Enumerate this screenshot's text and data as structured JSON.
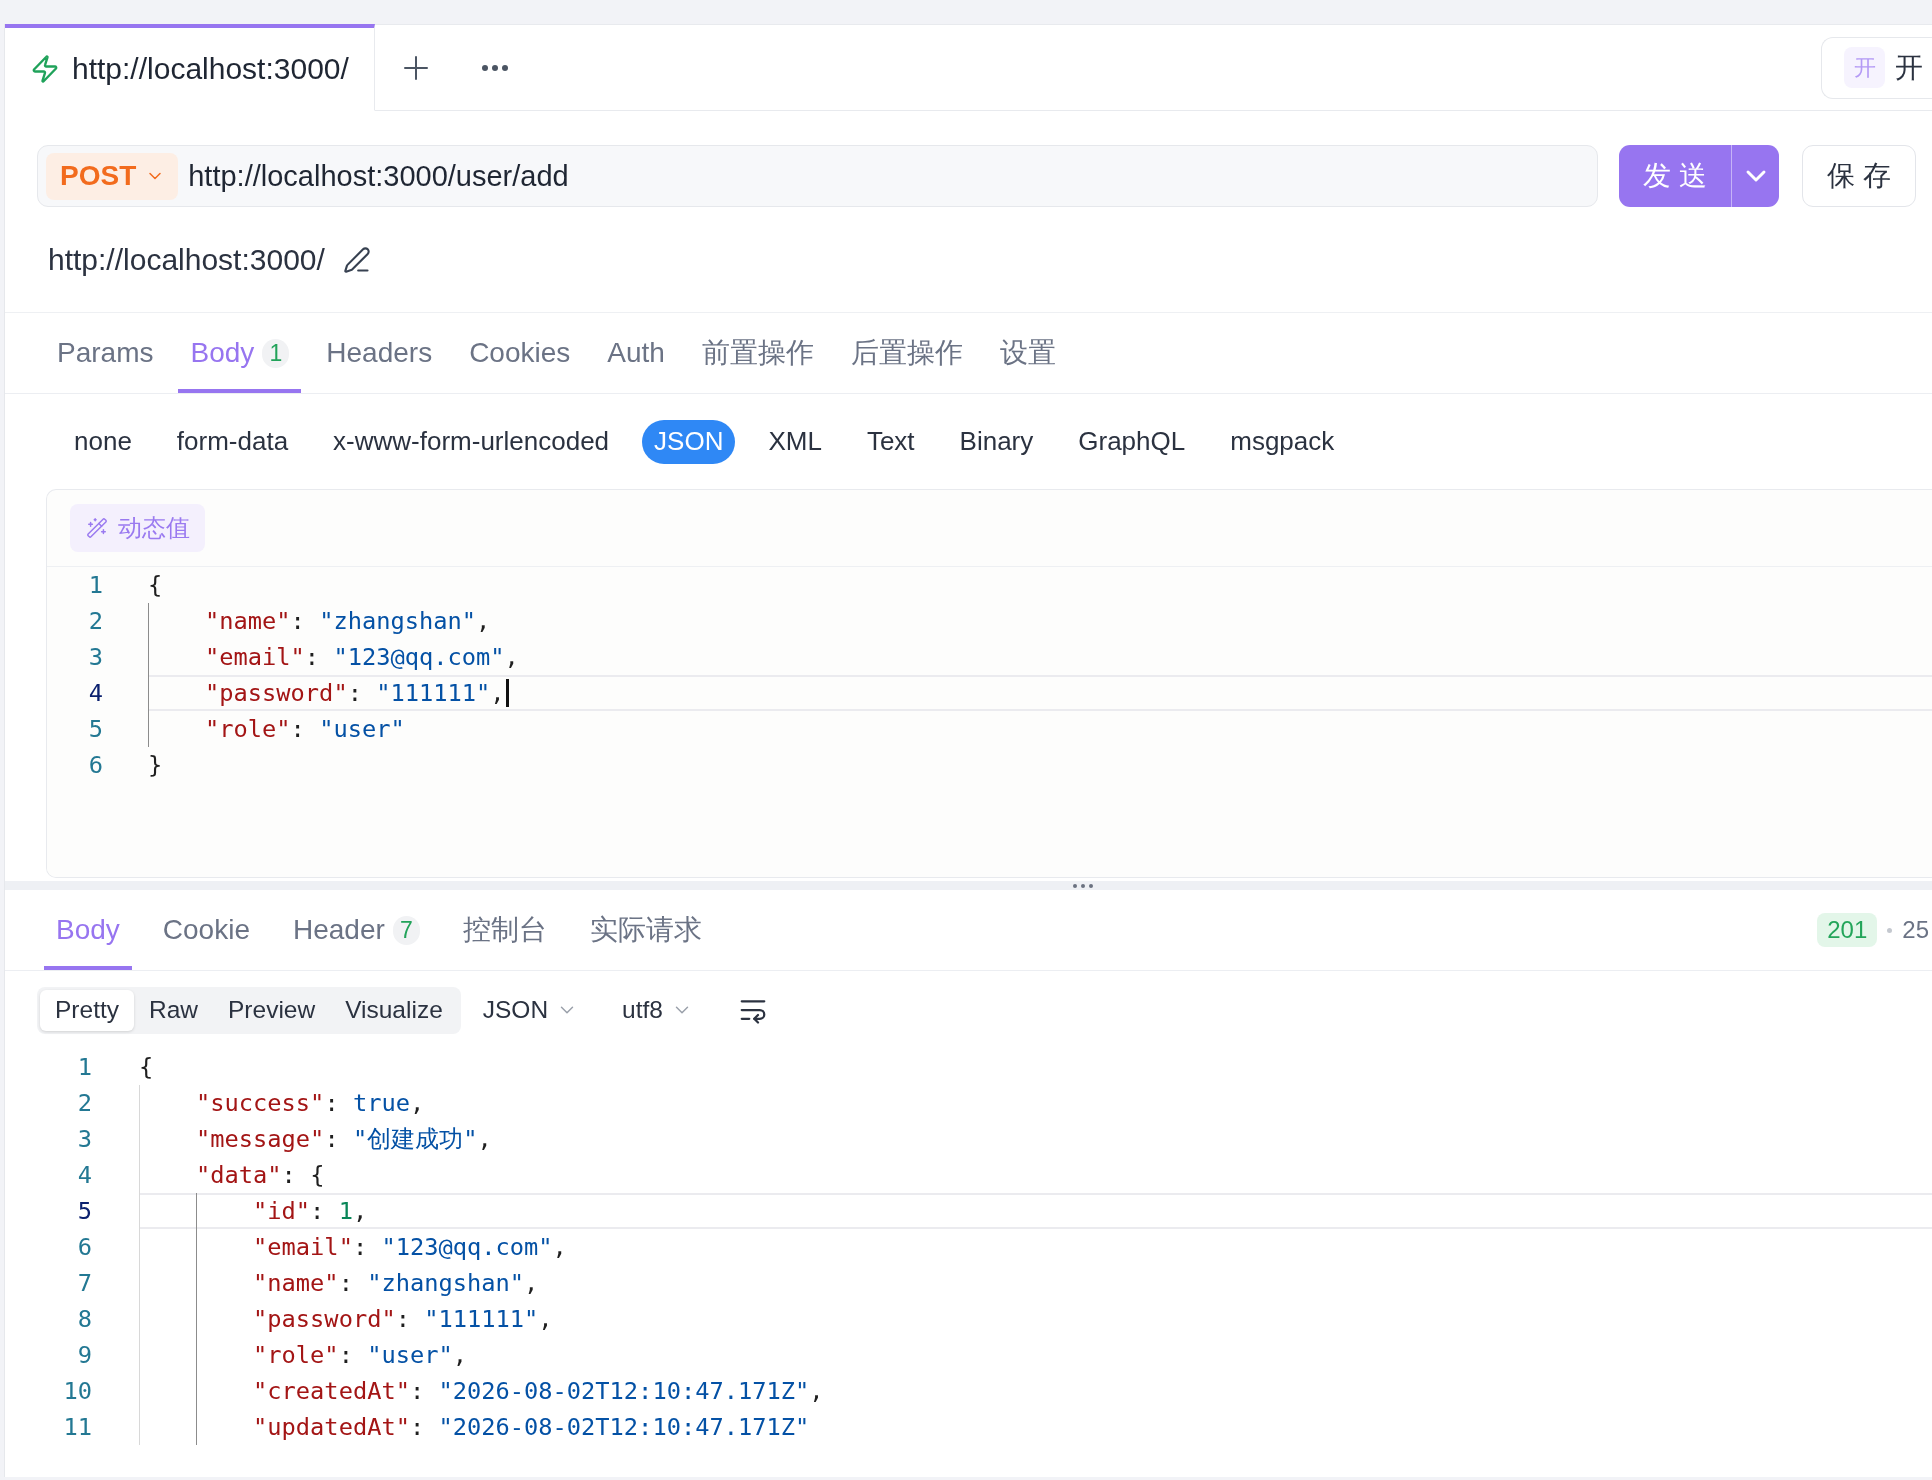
{
  "tabs": [
    {
      "label": "http://localhost:3000/",
      "selected": true
    }
  ],
  "environment": {
    "avatar": "开",
    "name": "开"
  },
  "request": {
    "method": "POST",
    "url": "http://localhost:3000/user/add",
    "send_label": "发 送",
    "save_label": "保 存",
    "base_url": "http://localhost:3000/"
  },
  "request_tabs": [
    {
      "label": "Params",
      "selected": false
    },
    {
      "label": "Body",
      "badge": "1",
      "selected": true
    },
    {
      "label": "Headers",
      "selected": false
    },
    {
      "label": "Cookies",
      "selected": false
    },
    {
      "label": "Auth",
      "selected": false
    },
    {
      "label": "前置操作",
      "selected": false
    },
    {
      "label": "后置操作",
      "selected": false
    },
    {
      "label": "设置",
      "selected": false
    }
  ],
  "body_types": [
    {
      "label": "none",
      "selected": false
    },
    {
      "label": "form-data",
      "selected": false
    },
    {
      "label": "x-www-form-urlencoded",
      "selected": false
    },
    {
      "label": "JSON",
      "selected": true
    },
    {
      "label": "XML",
      "selected": false
    },
    {
      "label": "Text",
      "selected": false
    },
    {
      "label": "Binary",
      "selected": false
    },
    {
      "label": "GraphQL",
      "selected": false
    },
    {
      "label": "msgpack",
      "selected": false
    }
  ],
  "body_editor": {
    "dynamic_value_button": "动态值",
    "focused": true,
    "lines": [
      {
        "number": "1",
        "current": false,
        "tokens": [
          {
            "kind": "open",
            "text": "{"
          }
        ]
      },
      {
        "number": "2",
        "current": false,
        "tokens": [
          {
            "kind": "key",
            "text": "\"name\""
          },
          {
            "kind": "punct",
            "text": ": "
          },
          {
            "kind": "string",
            "text": "\"zhangshan\""
          },
          {
            "kind": "punct",
            "text": ","
          }
        ]
      },
      {
        "number": "3",
        "current": false,
        "tokens": [
          {
            "kind": "key",
            "text": "\"email\""
          },
          {
            "kind": "punct",
            "text": ": "
          },
          {
            "kind": "string",
            "text": "\"123@qq.com\""
          },
          {
            "kind": "punct",
            "text": ","
          }
        ]
      },
      {
        "number": "4",
        "current": true,
        "tokens": [
          {
            "kind": "key",
            "text": "\"password\""
          },
          {
            "kind": "punct",
            "text": ": "
          },
          {
            "kind": "string",
            "text": "\"111111\""
          },
          {
            "kind": "punct",
            "text": ","
          }
        ]
      },
      {
        "number": "5",
        "current": false,
        "tokens": [
          {
            "kind": "key",
            "text": "\"role\""
          },
          {
            "kind": "punct",
            "text": ": "
          },
          {
            "kind": "string",
            "text": "\"user\""
          }
        ]
      },
      {
        "number": "6",
        "current": false,
        "tokens": [
          {
            "kind": "close",
            "text": "}"
          }
        ]
      }
    ]
  },
  "response": {
    "tabs": [
      {
        "label": "Body",
        "selected": true
      },
      {
        "label": "Cookie",
        "selected": false
      },
      {
        "label": "Header",
        "badge": "7",
        "selected": false
      },
      {
        "label": "控制台",
        "selected": false
      },
      {
        "label": "实际请求",
        "selected": false
      }
    ],
    "status": "201",
    "stat_2": "25",
    "view_modes": [
      {
        "label": "Pretty",
        "selected": true
      },
      {
        "label": "Raw",
        "selected": false
      },
      {
        "label": "Preview",
        "selected": false
      },
      {
        "label": "Visualize",
        "selected": false
      }
    ],
    "format": "JSON",
    "encoding": "utf8",
    "viewer": {
      "lines": [
        {
          "number": "1",
          "current": false,
          "tokens": [
            {
              "kind": "open",
              "text": "{"
            }
          ]
        },
        {
          "number": "2",
          "current": false,
          "tokens": [
            {
              "kind": "key",
              "text": "\"success\""
            },
            {
              "kind": "punct",
              "text": ": "
            },
            {
              "kind": "boolean",
              "text": "true"
            },
            {
              "kind": "punct",
              "text": ","
            }
          ]
        },
        {
          "number": "3",
          "current": false,
          "tokens": [
            {
              "kind": "key",
              "text": "\"message\""
            },
            {
              "kind": "punct",
              "text": ": "
            },
            {
              "kind": "string",
              "text": "\"创建成功\""
            },
            {
              "kind": "punct",
              "text": ","
            }
          ]
        },
        {
          "number": "4",
          "current": false,
          "tokens": [
            {
              "kind": "key",
              "text": "\"data\""
            },
            {
              "kind": "punct",
              "text": ": "
            },
            {
              "kind": "open",
              "text": "{"
            }
          ]
        },
        {
          "number": "5",
          "current": true,
          "tokens": [
            {
              "kind": "key",
              "text": "\"id\""
            },
            {
              "kind": "punct",
              "text": ": "
            },
            {
              "kind": "number",
              "text": "1"
            },
            {
              "kind": "punct",
              "text": ","
            }
          ]
        },
        {
          "number": "6",
          "current": false,
          "tokens": [
            {
              "kind": "key",
              "text": "\"email\""
            },
            {
              "kind": "punct",
              "text": ": "
            },
            {
              "kind": "string",
              "text": "\"123@qq.com\""
            },
            {
              "kind": "punct",
              "text": ","
            }
          ]
        },
        {
          "number": "7",
          "current": false,
          "tokens": [
            {
              "kind": "key",
              "text": "\"name\""
            },
            {
              "kind": "punct",
              "text": ": "
            },
            {
              "kind": "string",
              "text": "\"zhangshan\""
            },
            {
              "kind": "punct",
              "text": ","
            }
          ]
        },
        {
          "number": "8",
          "current": false,
          "tokens": [
            {
              "kind": "key",
              "text": "\"password\""
            },
            {
              "kind": "punct",
              "text": ": "
            },
            {
              "kind": "string",
              "text": "\"111111\""
            },
            {
              "kind": "punct",
              "text": ","
            }
          ]
        },
        {
          "number": "9",
          "current": false,
          "tokens": [
            {
              "kind": "key",
              "text": "\"role\""
            },
            {
              "kind": "punct",
              "text": ": "
            },
            {
              "kind": "string",
              "text": "\"user\""
            },
            {
              "kind": "punct",
              "text": ","
            }
          ]
        },
        {
          "number": "10",
          "current": false,
          "tokens": [
            {
              "kind": "key",
              "text": "\"createdAt\""
            },
            {
              "kind": "punct",
              "text": ": "
            },
            {
              "kind": "string",
              "text": "\"2026-08-02T12:10:47.171Z\""
            },
            {
              "kind": "punct",
              "text": ","
            }
          ]
        },
        {
          "number": "11",
          "current": false,
          "tokens": [
            {
              "kind": "key",
              "text": "\"updatedAt\""
            },
            {
              "kind": "punct",
              "text": ": "
            },
            {
              "kind": "string",
              "text": "\"2026-08-02T12:10:47.171Z\""
            }
          ]
        }
      ]
    }
  }
}
